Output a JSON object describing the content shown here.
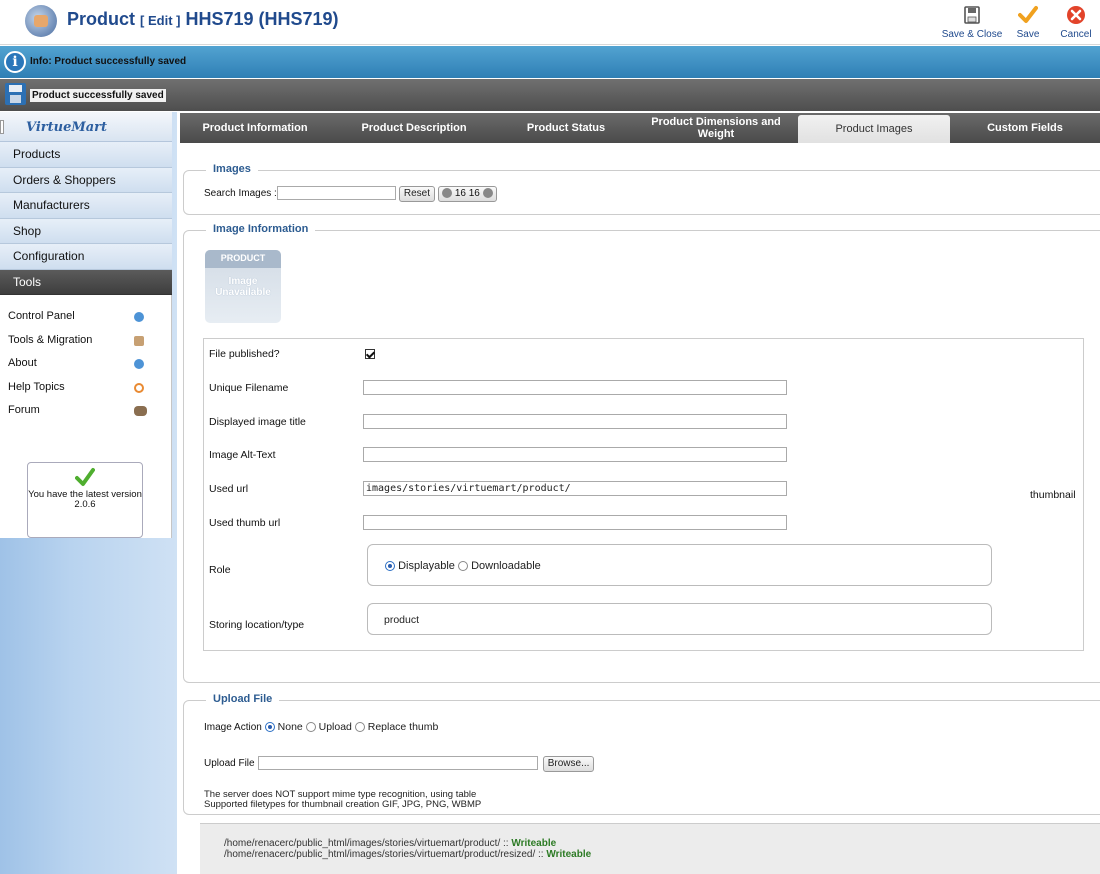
{
  "header": {
    "title": "Product",
    "edit_tag": "[ Edit ]",
    "record": "HHS719 (HHS719)",
    "buttons": {
      "save_close": "Save & Close",
      "save": "Save",
      "cancel": "Cancel"
    }
  },
  "messages": {
    "info": "Info: Product successfully saved",
    "saved": "Product successfully saved"
  },
  "sidebar": {
    "brand": "VirtueMart",
    "items": [
      "Products",
      "Orders & Shoppers",
      "Manufacturers",
      "Shop",
      "Configuration",
      "Tools"
    ],
    "active_item": "Tools",
    "tools": [
      "Control Panel",
      "Tools & Migration",
      "About",
      "Help Topics",
      "Forum"
    ],
    "version_note": "You have the latest version",
    "version_number": "2.0.6"
  },
  "tabs": {
    "items": [
      "Product Information",
      "Product Description",
      "Product Status",
      "Product Dimensions and Weight",
      "Product Images",
      "Custom Fields"
    ],
    "active": "Product Images"
  },
  "images_section": {
    "legend": "Images",
    "search_label": "Search Images :",
    "search_value": "",
    "reset_label": "Reset",
    "page_size_a": "16",
    "page_size_b": "16"
  },
  "image_info": {
    "legend": "Image Information",
    "placeholder_top": "PRODUCT",
    "placeholder_line1": "Image",
    "placeholder_line2": "Unavailable",
    "file_published_label": "File published?",
    "file_published": true,
    "unique_filename_label": "Unique Filename",
    "unique_filename": "",
    "display_title_label": "Displayed image title",
    "display_title": "",
    "alt_text_label": "Image Alt-Text",
    "alt_text": "",
    "used_url_label": "Used url",
    "used_url": "images/stories/virtuemart/product/",
    "thumbnail_label": "thumbnail",
    "used_thumb_url_label": "Used thumb url",
    "used_thumb_url": "",
    "role_label": "Role",
    "role_options": [
      "Displayable",
      "Downloadable"
    ],
    "role_selected": "Displayable",
    "storing_label": "Storing location/type",
    "storing_value": "product"
  },
  "upload": {
    "legend": "Upload File",
    "action_label": "Image Action",
    "action_options": [
      "None",
      "Upload",
      "Replace thumb"
    ],
    "action_selected": "None",
    "file_label": "Upload File",
    "browse_label": "Browse...",
    "note_line1": "The server does NOT support mime type recognition, using table",
    "note_line2": "Supported filetypes for thumbnail creation GIF, JPG, PNG, WBMP"
  },
  "paths": {
    "path1": "/home/renacerc/public_html/images/stories/virtuemart/product/ ::",
    "path2": "/home/renacerc/public_html/images/stories/virtuemart/product/resized/ ::",
    "status": "Writeable"
  },
  "colors": {
    "title_blue": "#204a8d",
    "info_bar": "#3a8ec4",
    "message_bar": "#5d5d5d",
    "legend_blue": "#2d5c91",
    "writeable_green": "#2d7b25",
    "cancel_red": "#e2432a",
    "save_orange": "#f0a11f"
  }
}
